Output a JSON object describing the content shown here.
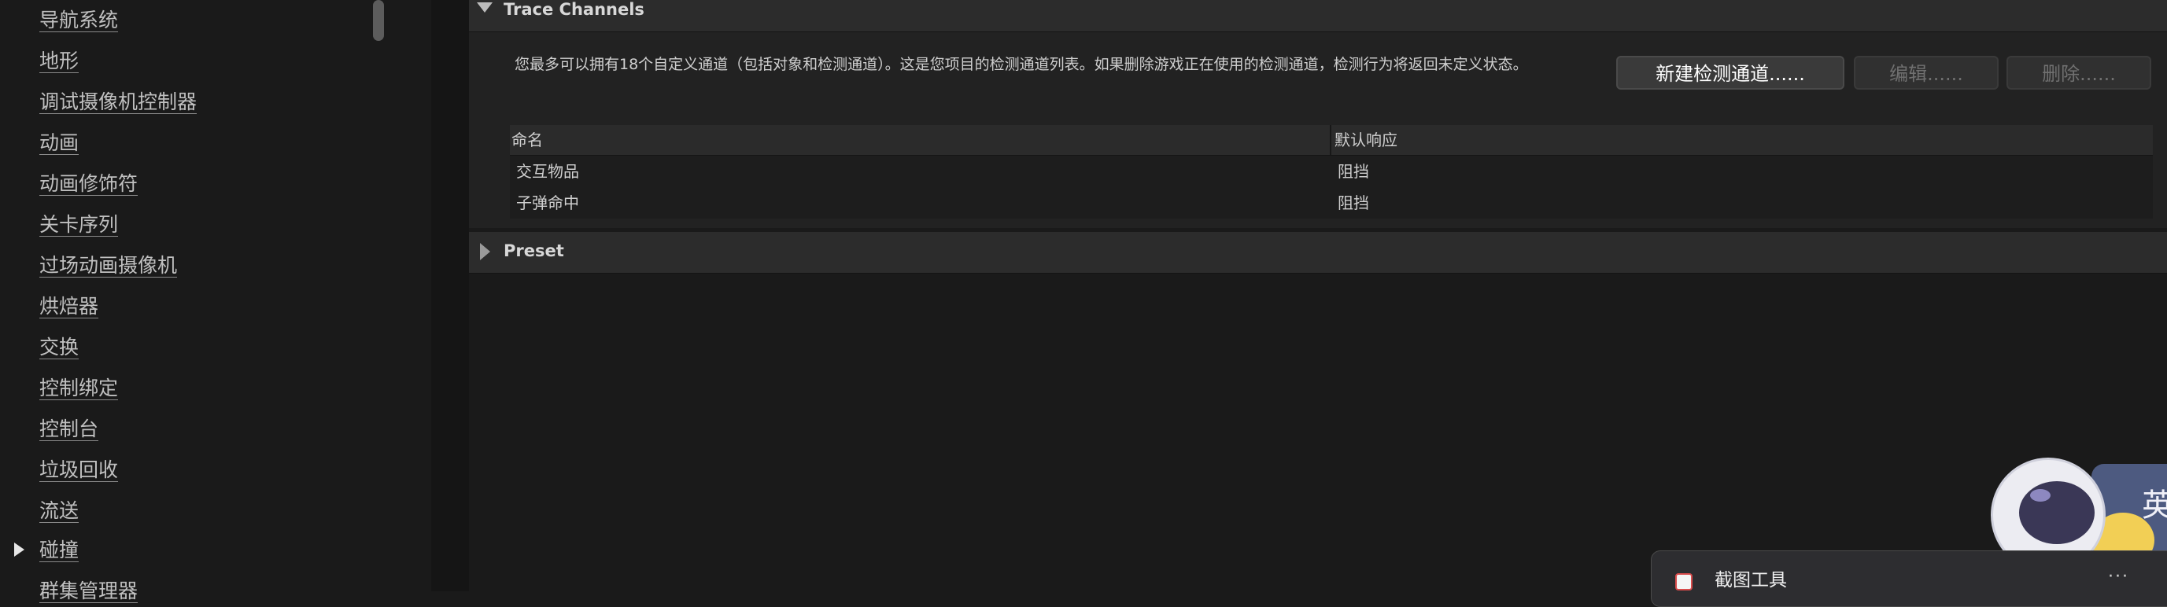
{
  "sidebar": {
    "items": [
      {
        "label": "导航系统"
      },
      {
        "label": "地形"
      },
      {
        "label": "调试摄像机控制器"
      },
      {
        "label": "动画"
      },
      {
        "label": "动画修饰符"
      },
      {
        "label": "关卡序列"
      },
      {
        "label": "过场动画摄像机"
      },
      {
        "label": "烘焙器"
      },
      {
        "label": "交换"
      },
      {
        "label": "控制绑定"
      },
      {
        "label": "控制台"
      },
      {
        "label": "垃圾回收"
      },
      {
        "label": "流送"
      },
      {
        "label": "碰撞"
      },
      {
        "label": "群集管理器"
      }
    ],
    "expanded_item_icon": "caret-right-icon"
  },
  "trace_channels": {
    "title": "Trace Channels",
    "description": "您最多可以拥有18个自定义通道（包括对象和检测通道）。这是您项目的检测通道列表。如果删除游戏正在使用的检测通道，检测行为将返回未定义状态。",
    "buttons": {
      "new_label": "新建检测通道......",
      "edit_label": "编辑......",
      "delete_label": "删除......"
    },
    "table": {
      "columns": [
        "命名",
        "默认响应"
      ],
      "rows": [
        {
          "name": "交互物品",
          "response": "阻挡"
        },
        {
          "name": "子弹命中",
          "response": "阻挡"
        }
      ]
    }
  },
  "preset": {
    "title": "Preset"
  },
  "overlay": {
    "widget_char": "英",
    "snip_tool_title": "截图工具",
    "snip_more": "···"
  },
  "colors": {
    "background": "#1a1a1a",
    "header": "#2c2c2c",
    "body": "#222222"
  }
}
